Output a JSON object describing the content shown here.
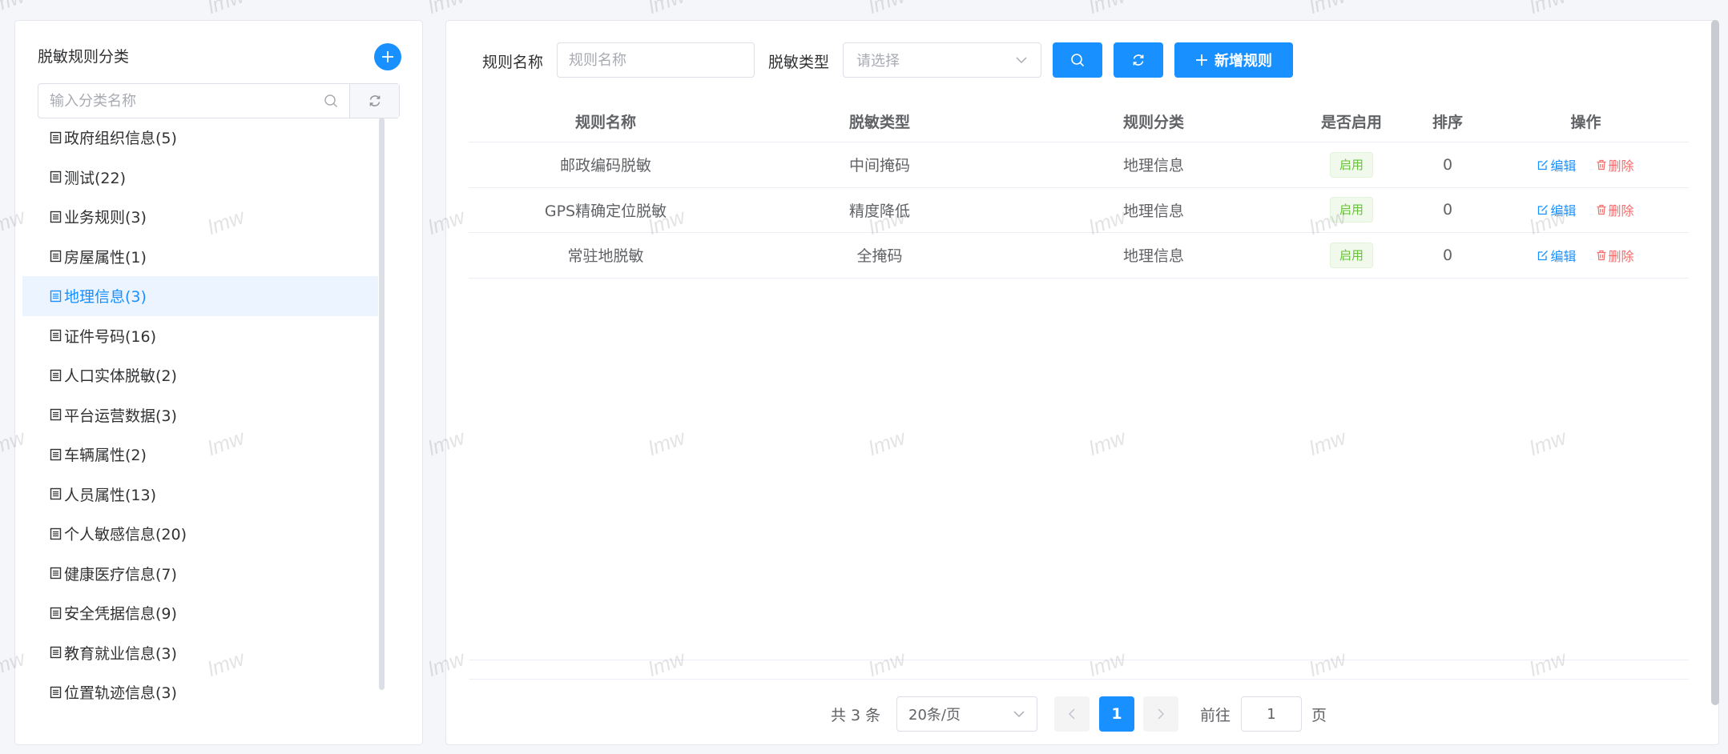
{
  "sidebar": {
    "title": "脱敏规则分类",
    "search_placeholder": "输入分类名称",
    "items": [
      {
        "label": "政府组织信息(5)",
        "active": false
      },
      {
        "label": "测试(22)",
        "active": false
      },
      {
        "label": "业务规则(3)",
        "active": false
      },
      {
        "label": "房屋属性(1)",
        "active": false
      },
      {
        "label": "地理信息(3)",
        "active": true
      },
      {
        "label": "证件号码(16)",
        "active": false
      },
      {
        "label": "人口实体脱敏(2)",
        "active": false
      },
      {
        "label": "平台运营数据(3)",
        "active": false
      },
      {
        "label": "车辆属性(2)",
        "active": false
      },
      {
        "label": "人员属性(13)",
        "active": false
      },
      {
        "label": "个人敏感信息(20)",
        "active": false
      },
      {
        "label": "健康医疗信息(7)",
        "active": false
      },
      {
        "label": "安全凭据信息(9)",
        "active": false
      },
      {
        "label": "教育就业信息(3)",
        "active": false
      },
      {
        "label": "位置轨迹信息(3)",
        "active": false
      }
    ]
  },
  "filter": {
    "rule_name_label": "规则名称",
    "rule_name_placeholder": "规则名称",
    "mask_type_label": "脱敏类型",
    "mask_type_placeholder": "请选择",
    "add_rule_label": "新增规则"
  },
  "table": {
    "columns": [
      "规则名称",
      "脱敏类型",
      "规则分类",
      "是否启用",
      "排序",
      "操作"
    ],
    "rows": [
      {
        "name": "邮政编码脱敏",
        "type": "中间掩码",
        "category": "地理信息",
        "enabled": "启用",
        "order": "0"
      },
      {
        "name": "GPS精确定位脱敏",
        "type": "精度降低",
        "category": "地理信息",
        "enabled": "启用",
        "order": "0"
      },
      {
        "name": "常驻地脱敏",
        "type": "全掩码",
        "category": "地理信息",
        "enabled": "启用",
        "order": "0"
      }
    ],
    "edit_label": "编辑",
    "delete_label": "删除"
  },
  "pagination": {
    "total": "共 3 条",
    "page_size": "20条/页",
    "current_page": "1",
    "goto_label": "前往",
    "goto_value": "1",
    "page_suffix": "页"
  },
  "watermark": "lmw",
  "colors": {
    "primary": "#1890ff",
    "success": "#67c23a",
    "danger": "#f56c6c"
  }
}
